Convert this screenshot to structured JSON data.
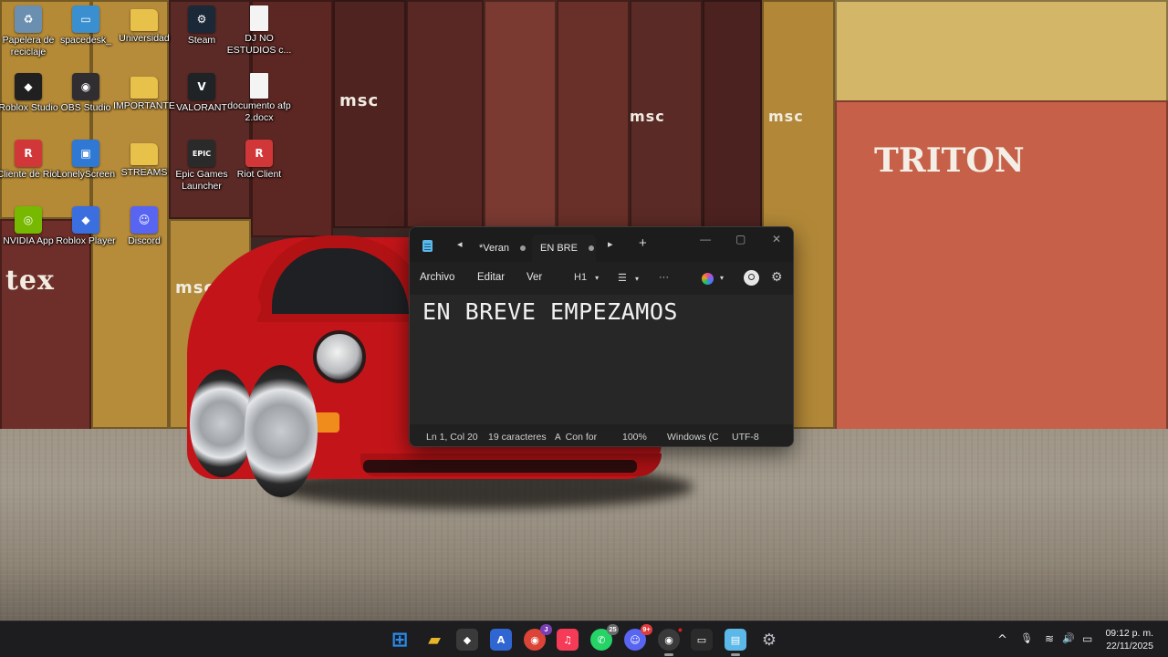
{
  "desktop": {
    "icons": [
      {
        "label": "Papelera de reciclaje",
        "icon": "recycle-bin-icon",
        "color": "#6a8fb0",
        "glyph": "♻"
      },
      {
        "label": "spacedesk_",
        "icon": "spacedesk-icon",
        "color": "#3a8fd0",
        "glyph": "▭"
      },
      {
        "label": "Universidad",
        "icon": "folder-icon",
        "color": "#e8c14a",
        "glyph": ""
      },
      {
        "label": "Steam",
        "icon": "steam-icon",
        "color": "#1b2838",
        "glyph": "⚙"
      },
      {
        "label": "DJ NO ESTUDIOS c...",
        "icon": "document-icon",
        "color": "#f4f4f4",
        "glyph": ""
      },
      {
        "label": "Roblox Studio",
        "icon": "roblox-studio-icon",
        "color": "#202020",
        "glyph": "◆"
      },
      {
        "label": "OBS Studio",
        "icon": "obs-icon",
        "color": "#302e31",
        "glyph": "◉"
      },
      {
        "label": "IMPORTANTE",
        "icon": "folder-icon",
        "color": "#e8c14a",
        "glyph": ""
      },
      {
        "label": "VALORANT",
        "icon": "valorant-icon",
        "color": "#1f2326",
        "glyph": "V"
      },
      {
        "label": "documento afp 2.docx",
        "icon": "document-icon",
        "color": "#f4f4f4",
        "glyph": ""
      },
      {
        "label": "Cliente de Riot",
        "icon": "riot-client-icon",
        "color": "#d13639",
        "glyph": "R"
      },
      {
        "label": "LonelyScreen",
        "icon": "lonelyscreen-icon",
        "color": "#2f78d4",
        "glyph": "▣"
      },
      {
        "label": "STREAMS",
        "icon": "folder-icon",
        "color": "#e8c14a",
        "glyph": ""
      },
      {
        "label": "Epic Games Launcher",
        "icon": "epic-games-icon",
        "color": "#2a2a2a",
        "glyph": "EPIC"
      },
      {
        "label": "Riot Client",
        "icon": "riot-client-icon",
        "color": "#d13639",
        "glyph": "R"
      },
      {
        "label": "NVIDIA App",
        "icon": "nvidia-icon",
        "color": "#76b900",
        "glyph": "◎"
      },
      {
        "label": "Roblox Player",
        "icon": "roblox-player-icon",
        "color": "#3b6fe0",
        "glyph": "◆"
      },
      {
        "label": "Discord",
        "icon": "discord-icon",
        "color": "#5865f2",
        "glyph": "☺"
      }
    ],
    "container_text_triton": "TRITON",
    "container_text_msc": "msc",
    "container_text_tex": "tex"
  },
  "notepad": {
    "tabs": [
      {
        "label": "*Veran",
        "active": false
      },
      {
        "label": "EN BRE",
        "active": true
      }
    ],
    "menu": {
      "file": "Archivo",
      "edit": "Editar",
      "view": "Ver"
    },
    "toolbar": {
      "heading": "H1",
      "list": "☰",
      "more": "···"
    },
    "content": "EN BREVE EMPEZAMOS",
    "status": {
      "position": "Ln 1, Col 20",
      "characters": "19 caracteres",
      "format": "Con for",
      "zoom": "100%",
      "line_ending": "Windows (C",
      "encoding": "UTF-8"
    }
  },
  "taskbar": {
    "apps": [
      {
        "name": "start-button",
        "glyph": "⊞",
        "color": "#2a8cf0",
        "badge": ""
      },
      {
        "name": "file-explorer-icon",
        "glyph": "▰",
        "color": "#e8b42a",
        "badge": ""
      },
      {
        "name": "unity-hub-icon",
        "glyph": "◆",
        "color": "#3a3a3a",
        "badge": ""
      },
      {
        "name": "visual-studio-icon",
        "glyph": "A",
        "color": "#2f66d2",
        "badge": ""
      },
      {
        "name": "chrome-icon",
        "glyph": "◉",
        "color": "#db4437",
        "badge": "J"
      },
      {
        "name": "apple-music-icon",
        "glyph": "♫",
        "color": "#f53b57",
        "badge": ""
      },
      {
        "name": "whatsapp-icon",
        "glyph": "✆",
        "color": "#25d366",
        "badge": "25"
      },
      {
        "name": "discord-icon",
        "glyph": "☺",
        "color": "#5865f2",
        "badge": "9+"
      },
      {
        "name": "obs-icon",
        "glyph": "◉",
        "color": "#3a3a3a",
        "badge": "●"
      },
      {
        "name": "nvidia-app-icon",
        "glyph": "▭",
        "color": "#2b2b2b",
        "badge": ""
      },
      {
        "name": "notepad-icon",
        "glyph": "▤",
        "color": "#5bb8e8",
        "badge": ""
      },
      {
        "name": "settings-icon",
        "glyph": "⚙",
        "color": "#8a8f98",
        "badge": ""
      }
    ],
    "tray": {
      "chevron": "^",
      "mic": "🎙",
      "wifi": "≋",
      "volume": "🔊",
      "battery": "▭"
    },
    "clock": {
      "time": "09:12 p. m.",
      "date": "22/11/2025"
    }
  }
}
